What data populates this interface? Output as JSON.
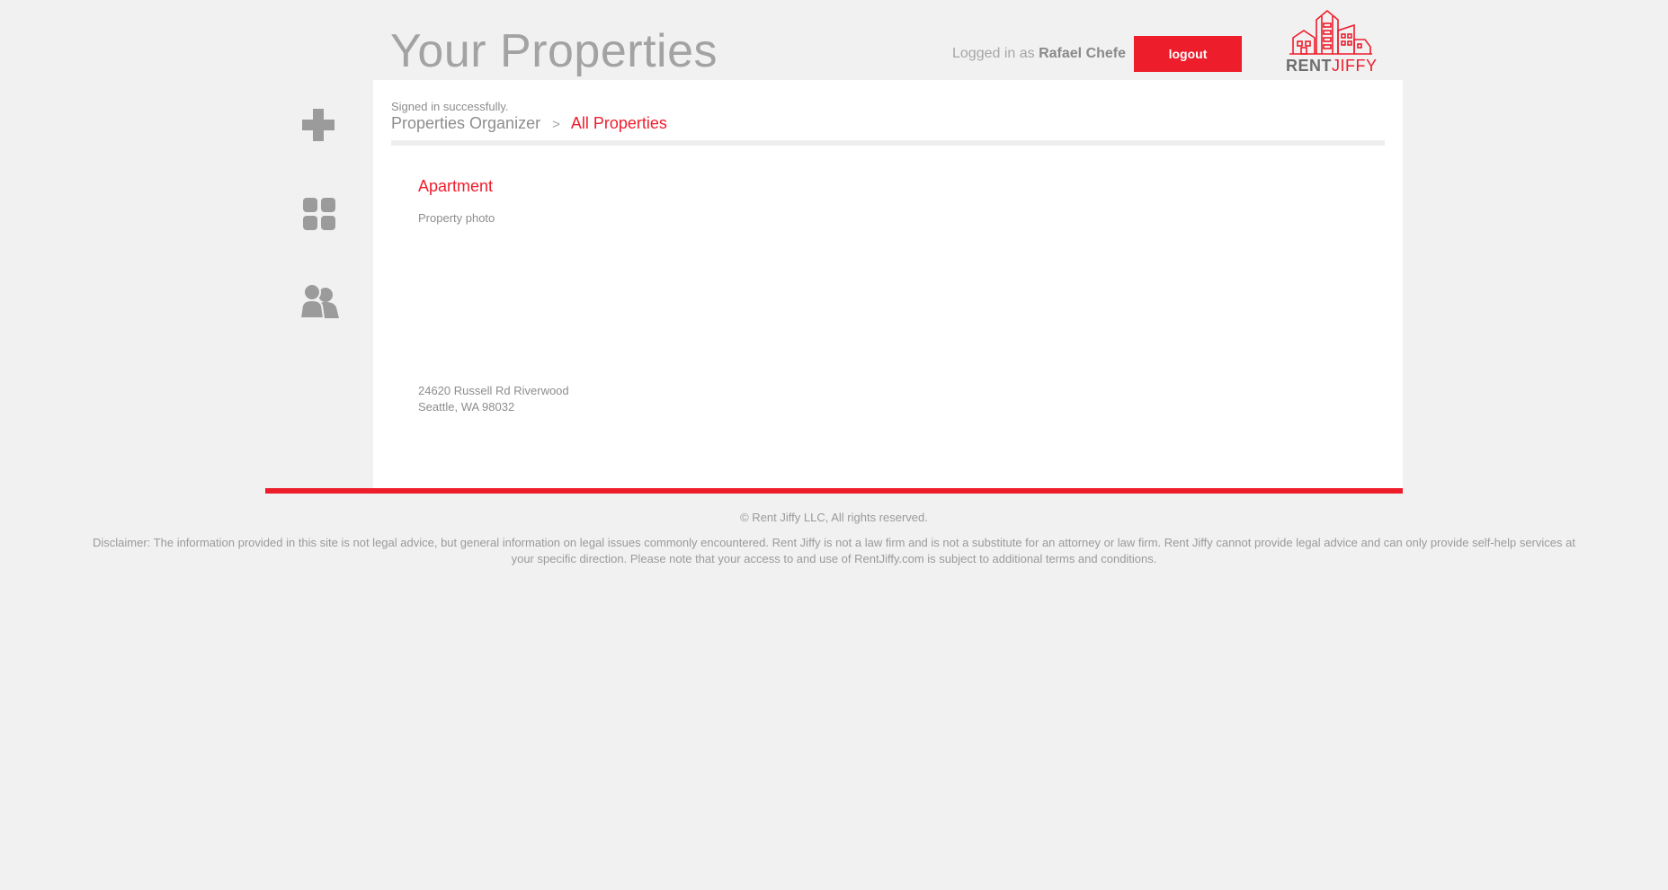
{
  "header": {
    "title": "Your Properties",
    "logged_in_prefix": "Logged in as",
    "user_name": "Rafael Chefe",
    "logout_label": "logout"
  },
  "logo": {
    "text_bold": "RENT",
    "text_light": "JIFFY"
  },
  "sidebar": {
    "items": [
      {
        "icon": "plus-icon"
      },
      {
        "icon": "grid-icon"
      },
      {
        "icon": "users-icon"
      }
    ]
  },
  "main": {
    "flash_message": "Signed in successfully.",
    "breadcrumb": {
      "root": "Properties Organizer",
      "separator": ">",
      "current": "All Properties"
    },
    "property": {
      "type": "Apartment",
      "photo_label": "Property photo",
      "address_line1": "24620 Russell Rd Riverwood",
      "address_line2": "Seattle, WA 98032"
    }
  },
  "footer": {
    "copyright": "© Rent Jiffy LLC, All rights reserved.",
    "disclaimer": "Disclaimer: The information provided in this site is not legal advice, but general information on legal issues commonly encountered. Rent Jiffy is not a law firm and is not a substitute for an attorney or law firm. Rent Jiffy cannot provide legal advice and can only provide self-help services at your specific direction. Please note that your access to and use of RentJiffy.com is subject to additional terms and conditions."
  },
  "colors": {
    "accent": "#ee1d2c",
    "background": "#f1f1f1",
    "panel": "#ffffff",
    "icon_gray": "#9b9b9b"
  }
}
